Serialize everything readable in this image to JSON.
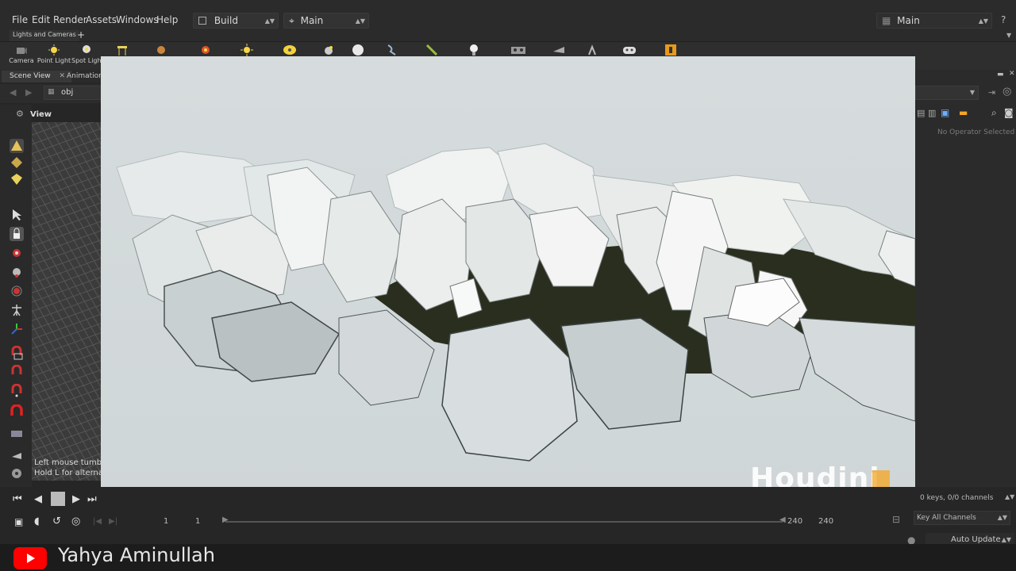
{
  "menu": {
    "items": [
      "File",
      "Edit",
      "Render",
      "Assets",
      "Windows",
      "Help"
    ],
    "desktop_label": "Build",
    "context_label": "Main",
    "right_label": "Main"
  },
  "shelf": {
    "tab": "Lights and Cameras",
    "add_label": "+",
    "tools": [
      {
        "label": "Camera",
        "icon": "camera-icon"
      },
      {
        "label": "Point Light",
        "icon": "point-light-icon"
      },
      {
        "label": "Spot Light",
        "icon": "spot-light-icon"
      }
    ]
  },
  "left_pane": {
    "tabs": [
      "Scene View",
      "Animation"
    ],
    "path": "obj",
    "view_label": "View",
    "hint_line1": "Left mouse tumbles",
    "hint_line2": "Hold L for alternate"
  },
  "right_pane": {
    "status": "No Operator Selected",
    "channels": "0 keys, 0/0 channels",
    "key_all": "Key All Channels",
    "auto_update": "Auto Update"
  },
  "timeline": {
    "start": "1",
    "current": "1",
    "end_a": "240",
    "end_b": "240"
  },
  "watermark": {
    "text": "Houdini"
  },
  "footer": {
    "channel_name": "Yahya Aminullah"
  },
  "colors": {
    "accent": "#f5a623",
    "youtube": "#ff0000"
  }
}
